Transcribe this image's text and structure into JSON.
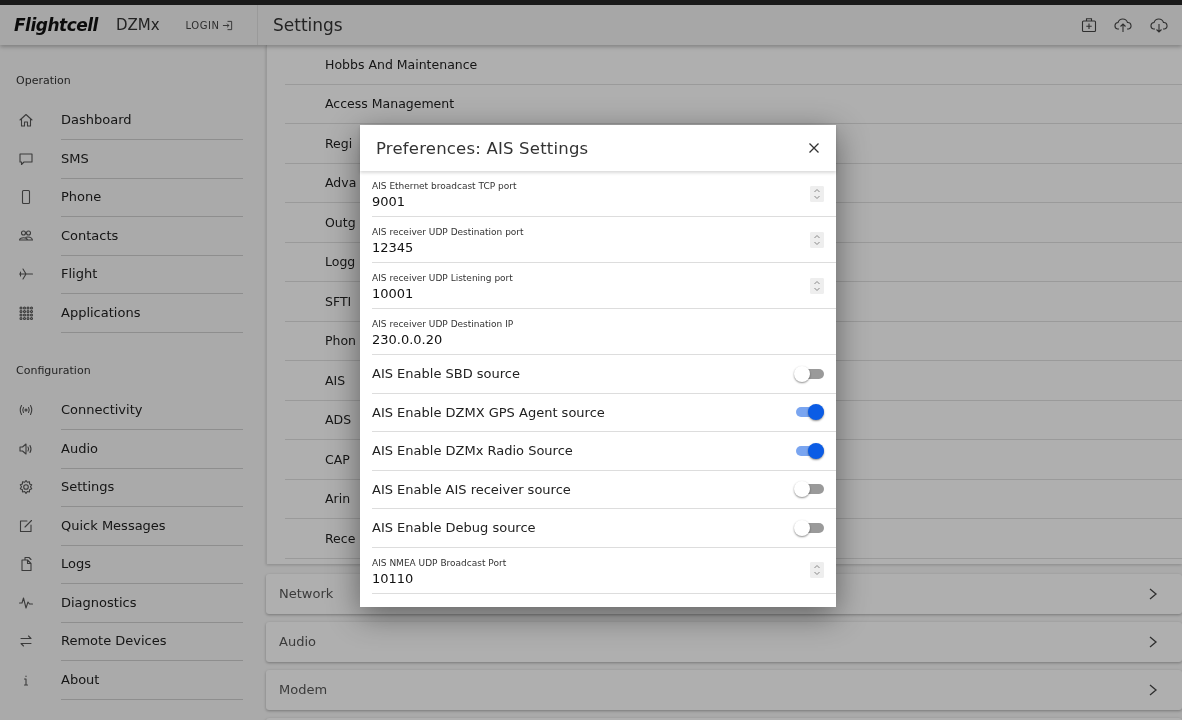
{
  "app": {
    "logo": "Flightcell",
    "product": "DZMx",
    "login": "LOGIN"
  },
  "header": {
    "title": "Settings"
  },
  "sidebar": {
    "sections": [
      {
        "title": "Operation",
        "items": [
          {
            "label": "Dashboard"
          },
          {
            "label": "SMS"
          },
          {
            "label": "Phone"
          },
          {
            "label": "Contacts"
          },
          {
            "label": "Flight"
          },
          {
            "label": "Applications"
          }
        ]
      },
      {
        "title": "Configuration",
        "items": [
          {
            "label": "Connectivity"
          },
          {
            "label": "Audio"
          },
          {
            "label": "Settings"
          },
          {
            "label": "Quick Messages"
          },
          {
            "label": "Logs"
          },
          {
            "label": "Diagnostics"
          },
          {
            "label": "Remote Devices"
          },
          {
            "label": "About"
          }
        ]
      }
    ]
  },
  "settings_list": [
    "Hobbs And Maintenance",
    "Access Management",
    "Regi",
    "Adva",
    "Outg",
    "Logg",
    "SFTI",
    "Phon",
    "AIS",
    "ADS",
    "CAP",
    "Arin",
    "Rece"
  ],
  "panels": [
    {
      "label": "Network"
    },
    {
      "label": "Audio"
    },
    {
      "label": "Modem"
    }
  ],
  "dialog": {
    "title": "Preferences: AIS Settings",
    "rows": [
      {
        "kind": "number",
        "label": "AIS Ethernet broadcast TCP port",
        "value": "9001"
      },
      {
        "kind": "number",
        "label": "AIS receiver UDP Destination port",
        "value": "12345"
      },
      {
        "kind": "number",
        "label": "AIS receiver UDP Listening port",
        "value": "10001"
      },
      {
        "kind": "text",
        "label": "AIS receiver UDP Destination IP",
        "value": "230.0.0.20"
      },
      {
        "kind": "toggle",
        "label": "AIS Enable SBD source",
        "on": false
      },
      {
        "kind": "toggle",
        "label": "AIS Enable DZMX GPS Agent source",
        "on": true
      },
      {
        "kind": "toggle",
        "label": "AIS Enable DZMx Radio Source",
        "on": true
      },
      {
        "kind": "toggle",
        "label": "AIS Enable AIS receiver source",
        "on": false
      },
      {
        "kind": "toggle",
        "label": "AIS Enable Debug source",
        "on": false
      },
      {
        "kind": "number",
        "label": "AIS NMEA UDP Broadcast Port",
        "value": "10110"
      }
    ]
  }
}
